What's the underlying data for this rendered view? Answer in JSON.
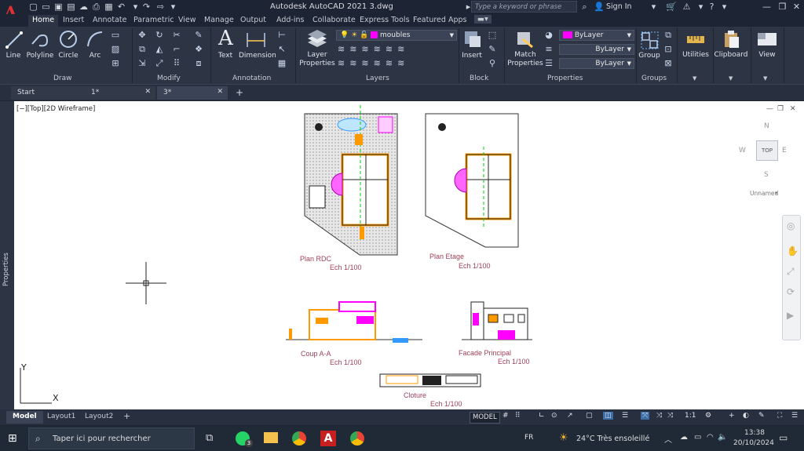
{
  "window": {
    "app_title": "Autodesk AutoCAD 2021   3.dwg",
    "search_placeholder": "Type a keyword or phrase",
    "sign_in": "Sign In"
  },
  "ribbon_tabs": [
    "Home",
    "Insert",
    "Annotate",
    "Parametric",
    "View",
    "Manage",
    "Output",
    "Add-ins",
    "Collaborate",
    "Express Tools",
    "Featured Apps"
  ],
  "active_ribbon_tab": "Home",
  "ribbon": {
    "draw": {
      "label": "Draw",
      "tools": [
        "Line",
        "Polyline",
        "Circle",
        "Arc"
      ]
    },
    "modify": {
      "label": "Modify"
    },
    "annotation": {
      "label": "Annotation",
      "tools": [
        "Text",
        "Dimension"
      ]
    },
    "layers": {
      "label": "Layers",
      "layer_properties": "Layer Properties",
      "current_layer": "moubles"
    },
    "block": {
      "label": "Block",
      "insert": "Insert"
    },
    "properties": {
      "label": "Properties",
      "match": "Match Properties",
      "color": "ByLayer",
      "linetype": "ByLayer",
      "lineweight": "ByLayer"
    },
    "groups": {
      "label": "Groups",
      "group": "Group"
    },
    "utilities": "Utilities",
    "clipboard": "Clipboard",
    "view": "View"
  },
  "doc_tabs": [
    {
      "label": "Start"
    },
    {
      "label": "1*"
    },
    {
      "label": "3*"
    }
  ],
  "viewport": {
    "label": "[−][Top][2D Wireframe]",
    "viewcube": {
      "n": "N",
      "s": "S",
      "e": "E",
      "w": "W",
      "top": "TOP",
      "ucs": "Unnamed"
    },
    "axis_y": "Y",
    "axis_x": "X"
  },
  "side_panel": "Properties",
  "drawing_labels": {
    "plan_rdc": "Plan RDC",
    "plan_rdc_scale": "Ech 1/100",
    "plan_etage": "Plan Etage",
    "plan_etage_scale": "Ech 1/100",
    "coup": "Coup A-A",
    "coup_scale": "Ech 1/100",
    "facade": "Facade Principal",
    "facade_scale": "Ech 1/100",
    "cloture": "Cloture",
    "cloture_scale": "Ech 1/100"
  },
  "layout_tabs": [
    "Model",
    "Layout1",
    "Layout2"
  ],
  "status": {
    "model": "MODEL",
    "scale": "1:1"
  },
  "taskbar": {
    "search": "Taper ici pour rechercher",
    "lang": "FR",
    "weather": "24°C  Très ensoleillé",
    "time": "13:38",
    "date": "20/10/2024",
    "whatsapp_badge": "3"
  },
  "colors": {
    "accent": "#e03030",
    "cad_label": "#a0405a",
    "magenta": "#ff00ff",
    "orange": "#ff9900",
    "green": "#00cc00"
  }
}
